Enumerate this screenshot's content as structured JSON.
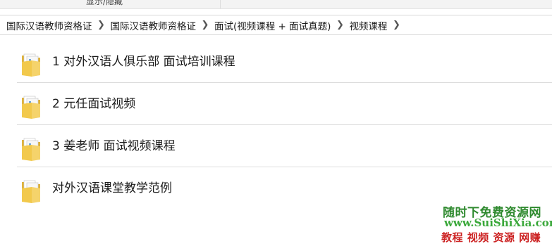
{
  "ribbon": {
    "show_hide_label": "显示/隐藏"
  },
  "breadcrumb": [
    "国际汉语教师资格证",
    "国际汉语教师资格证",
    "面试(视频课程 + 面试真题)",
    "视频课程"
  ],
  "folders": [
    {
      "name": "1 对外汉语人俱乐部 面试培训课程",
      "icon": "folder-with-documents-icon"
    },
    {
      "name": "2 元任面试视频",
      "icon": "folder-with-documents-icon"
    },
    {
      "name": "3 姜老师 面试视频课程",
      "icon": "folder-with-documents-icon"
    },
    {
      "name": "对外汉语课堂教学范例",
      "icon": "folder-with-documents-icon"
    }
  ],
  "watermark": {
    "line1": "随时下免费资源网",
    "line2": "www.SuiShiXia.com",
    "line3": "教程 视频 资源 网赚"
  },
  "colors": {
    "folder_body": "#f2c94c",
    "watermark_green": "#2f8a2f",
    "watermark_red": "#cc2222"
  }
}
